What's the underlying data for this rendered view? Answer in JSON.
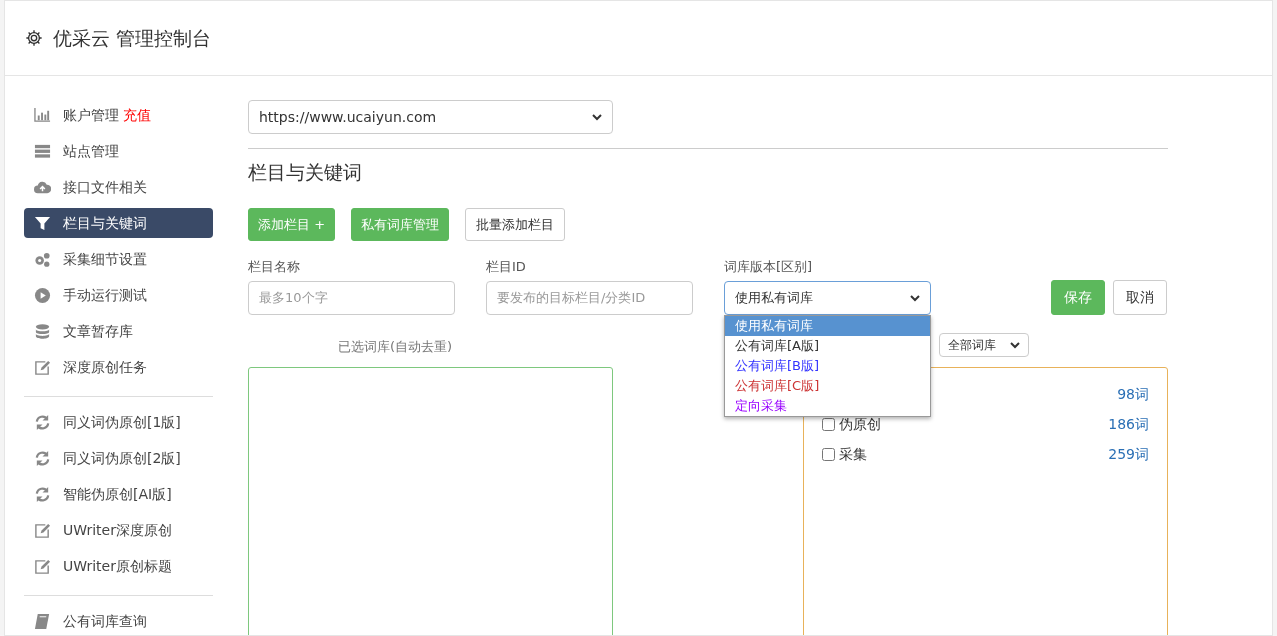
{
  "header": {
    "title": "优采云 管理控制台"
  },
  "sidebar": {
    "groups": [
      {
        "items": [
          {
            "label": "账户管理",
            "badge": "充值",
            "selected": false
          },
          {
            "label": "站点管理",
            "selected": false
          },
          {
            "label": "接口文件相关",
            "selected": false
          },
          {
            "label": "栏目与关键词",
            "selected": true
          },
          {
            "label": "采集细节设置",
            "selected": false
          },
          {
            "label": "手动运行测试",
            "selected": false
          },
          {
            "label": "文章暂存库",
            "selected": false
          },
          {
            "label": "深度原创任务",
            "selected": false
          }
        ]
      },
      {
        "items": [
          {
            "label": "同义词伪原创[1版]",
            "selected": false
          },
          {
            "label": "同义词伪原创[2版]",
            "selected": false
          },
          {
            "label": "智能伪原创[AI版]",
            "selected": false
          },
          {
            "label": "UWriter深度原创",
            "selected": false
          },
          {
            "label": "UWriter原创标题",
            "selected": false
          }
        ]
      },
      {
        "items": [
          {
            "label": "公有词库查询",
            "selected": false
          }
        ]
      }
    ]
  },
  "site_select": {
    "value": "https://www.ucaiyun.com"
  },
  "section_title": "栏目与关键词",
  "actions": [
    {
      "label": "添加栏目 +",
      "kind": "success"
    },
    {
      "label": "私有词库管理",
      "kind": "success"
    },
    {
      "label": "批量添加栏目",
      "kind": "outline"
    }
  ],
  "form": {
    "name_field": {
      "label": "栏目名称",
      "placeholder": "最多10个字"
    },
    "id_field": {
      "label": "栏目ID",
      "placeholder": "要发布的目标栏目/分类ID"
    },
    "library_select": {
      "label": "词库版本[区别]",
      "value": "使用私有词库",
      "expanded": true,
      "options": [
        {
          "label": "使用私有词库",
          "selected": true
        },
        {
          "label": "公有词库[A版]",
          "selected": false
        },
        {
          "label": "公有词库[B版]",
          "selected": false,
          "color": "#3333ff"
        },
        {
          "label": "公有词库[C版]",
          "selected": false,
          "color": "#cc3333"
        },
        {
          "label": "定向采集",
          "selected": false,
          "color": "#9900ff"
        }
      ]
    },
    "save_button": "保存",
    "cancel_button": "取消"
  },
  "selected_panel": {
    "label": "已选词库(自动去重)"
  },
  "library_panel": {
    "filter": "全部词库",
    "rows": [
      {
        "count": "98词"
      },
      {
        "label": "伪原创",
        "count": "186词",
        "checked": false
      },
      {
        "label": "采集",
        "count": "259词",
        "checked": false
      }
    ]
  }
}
